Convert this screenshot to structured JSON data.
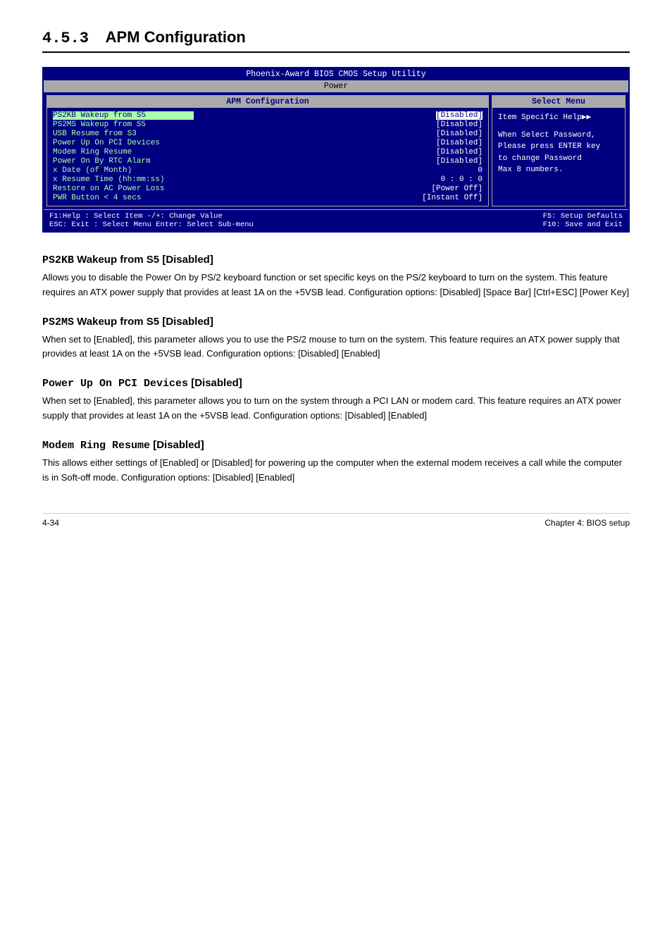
{
  "heading": {
    "number": "4.5.3",
    "title": "APM Configuration"
  },
  "bios": {
    "title": "Phoenix-Award BIOS CMOS Setup Utility",
    "tab": "Power",
    "left_panel_title": "APM Configuration",
    "right_panel_title": "Select Menu",
    "rows": [
      {
        "label": "PS2KB Wakeup from S5",
        "value": "[Disabled]",
        "selected": true,
        "highlighted": true
      },
      {
        "label": "PS2MS Wakeup from S5",
        "value": "[Disabled]",
        "selected": false,
        "highlighted": false
      },
      {
        "label": "USB Resume from  S3",
        "value": "[Disabled]",
        "selected": false,
        "highlighted": false
      },
      {
        "label": "Power Up On PCI Devices",
        "value": "[Disabled]",
        "selected": false,
        "highlighted": false
      },
      {
        "label": "Modem Ring Resume",
        "value": "[Disabled]",
        "selected": false,
        "highlighted": false
      },
      {
        "label": "  Power On By RTC Alarm",
        "value": "[Disabled]",
        "selected": false,
        "highlighted": false
      },
      {
        "label": "x Date (of Month)",
        "value": "  0",
        "selected": false,
        "highlighted": false
      },
      {
        "label": "x Resume Time (hh:mm:ss)",
        "value": "0 :  0 : 0",
        "selected": false,
        "highlighted": false
      },
      {
        "label": "  Restore on AC Power Loss",
        "value": "[Power Off]",
        "selected": false,
        "highlighted": false
      },
      {
        "label": "  PWR Button < 4 secs",
        "value": "[Instant Off]",
        "selected": false,
        "highlighted": false
      }
    ],
    "sidebar": {
      "help_title": "Item Specific Help▶▶",
      "help_text": "When Select Password,\nPlease press ENTER key\nto change Password\nMax 8 numbers."
    },
    "footer": {
      "left": [
        "F1:Help     : Select Item    -/+: Change Value",
        "ESC: Exit   : Select Menu    Enter: Select Sub-menu"
      ],
      "right": [
        "F5: Setup Defaults",
        "F10: Save and Exit"
      ]
    }
  },
  "sections": [
    {
      "id": "ps2kb",
      "title_prefix": "PS2KB",
      "title_rest": " Wakeup from S5 [Disabled]",
      "body": "Allows you to disable the Power On by PS/2 keyboard function or set specific keys on the PS/2 keyboard to turn on the system. This feature requires an ATX power supply that provides at least 1A on the +5VSB lead. Configuration options: [Disabled] [Space Bar] [Ctrl+ESC] [Power Key]"
    },
    {
      "id": "ps2ms",
      "title_prefix": "PS2MS",
      "title_rest": " Wakeup from S5 [Disabled]",
      "body": "When set to [Enabled], this parameter allows you to use the PS/2 mouse to turn on the system. This feature requires an ATX power supply that provides at least 1A on the +5VSB lead. Configuration options: [Disabled] [Enabled]"
    },
    {
      "id": "pcidev",
      "title_prefix": "Power Up On PCI Devices",
      "title_rest": " [Disabled]",
      "body": "When set to [Enabled], this parameter allows you to turn on the system through a PCI LAN or modem card. This feature requires an ATX power supply that provides at least 1A on the +5VSB lead. Configuration options: [Disabled] [Enabled]"
    },
    {
      "id": "modem",
      "title_prefix": "Modem Ring Resume",
      "title_rest": " [Disabled]",
      "body": "This allows either settings of [Enabled] or [Disabled] for powering up the computer when the external modem receives a call while the computer is in Soft-off mode. Configuration options: [Disabled] [Enabled]"
    }
  ],
  "page_footer": {
    "left": "4-34",
    "right": "Chapter 4: BIOS setup"
  }
}
